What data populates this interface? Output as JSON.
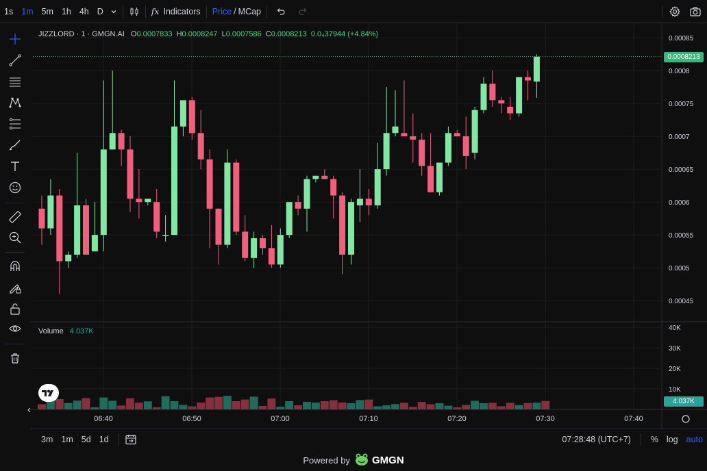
{
  "toolbar": {
    "timeframes": [
      "1s",
      "1m",
      "5m",
      "1h",
      "4h",
      "D"
    ],
    "active_timeframe": "1m",
    "indicators_label": "Indicators",
    "price_label": "Price",
    "slash": "/",
    "mcap_label": "MCap"
  },
  "legend": {
    "symbol": "JIZZLORD · 1 · GMGN.AI",
    "open_label": "O",
    "open": "0.0007833",
    "high_label": "H",
    "high": "0.0008247",
    "low_label": "L",
    "low": "0.0007586",
    "close_label": "C",
    "close": "0.0008213",
    "change": "0.0₄37944 (+4.84%)"
  },
  "volume_legend": {
    "label": "Volume",
    "value": "4.037K"
  },
  "last_price_tag": "0.0008213",
  "volume_tag": "4.037K",
  "bottombar": {
    "ranges": [
      "3m",
      "1m",
      "5d",
      "1d"
    ],
    "time": "07:28:48 (UTC+7)",
    "pct": "%",
    "log": "log",
    "auto": "auto"
  },
  "footer": {
    "powered_by": "Powered by",
    "brand": "GMGN"
  },
  "colors": {
    "up": "#80e8a3",
    "down": "#f0607d",
    "vol_up": "#1f6b5c",
    "vol_down": "#86303f",
    "accent": "#2962ff"
  },
  "chart_data": [
    {
      "type": "candlestick",
      "y_ticks": [
        "0.00085",
        "0.0008",
        "0.00075",
        "0.0007",
        "0.00065",
        "0.0006",
        "0.00055",
        "0.0005",
        "0.00045"
      ],
      "ylim": [
        0.00042,
        0.000872
      ],
      "x_ticks": [
        "06:40",
        "06:50",
        "07:00",
        "07:10",
        "07:20",
        "07:30",
        "07:40"
      ],
      "candles": [
        {
          "o": 0.00059,
          "h": 0.00061,
          "l": 0.000535,
          "c": 0.00056
        },
        {
          "o": 0.00056,
          "h": 0.000635,
          "l": 0.00055,
          "c": 0.00061
        },
        {
          "o": 0.00061,
          "h": 0.00062,
          "l": 0.00046,
          "c": 0.00051
        },
        {
          "o": 0.00051,
          "h": 0.000525,
          "l": 0.0005,
          "c": 0.00052
        },
        {
          "o": 0.00052,
          "h": 0.000675,
          "l": 0.000515,
          "c": 0.000595
        },
        {
          "o": 0.000595,
          "h": 0.000605,
          "l": 0.000525,
          "c": 0.00052
        },
        {
          "o": 0.000525,
          "h": 0.0006,
          "l": 0.000525,
          "c": 0.00055
        },
        {
          "o": 0.00055,
          "h": 0.000785,
          "l": 0.000525,
          "c": 0.00068
        },
        {
          "o": 0.00068,
          "h": 0.0008,
          "l": 0.00068,
          "c": 0.000705
        },
        {
          "o": 0.000705,
          "h": 0.00071,
          "l": 0.000655,
          "c": 0.00068
        },
        {
          "o": 0.00068,
          "h": 0.0007,
          "l": 0.000585,
          "c": 0.000605
        },
        {
          "o": 0.000605,
          "h": 0.00065,
          "l": 0.000575,
          "c": 0.0006
        },
        {
          "o": 0.0006,
          "h": 0.000605,
          "l": 0.000595,
          "c": 0.000605
        },
        {
          "o": 0.0006,
          "h": 0.00062,
          "l": 0.000545,
          "c": 0.000555
        },
        {
          "o": 0.00055,
          "h": 0.00058,
          "l": 0.00054,
          "c": 0.00055
        },
        {
          "o": 0.00055,
          "h": 0.000785,
          "l": 0.00055,
          "c": 0.000715
        },
        {
          "o": 0.000715,
          "h": 0.00075,
          "l": 0.0007,
          "c": 0.000755
        },
        {
          "o": 0.000755,
          "h": 0.00076,
          "l": 0.000695,
          "c": 0.000705
        },
        {
          "o": 0.000705,
          "h": 0.00074,
          "l": 0.00065,
          "c": 0.000665
        },
        {
          "o": 0.000665,
          "h": 0.00068,
          "l": 0.00053,
          "c": 0.00059
        },
        {
          "o": 0.00059,
          "h": 0.00059,
          "l": 0.000505,
          "c": 0.000535
        },
        {
          "o": 0.000535,
          "h": 0.00068,
          "l": 0.00053,
          "c": 0.00066
        },
        {
          "o": 0.00066,
          "h": 0.000665,
          "l": 0.00055,
          "c": 0.000555
        },
        {
          "o": 0.000555,
          "h": 0.00058,
          "l": 0.00051,
          "c": 0.000515
        },
        {
          "o": 0.000515,
          "h": 0.000555,
          "l": 0.0005,
          "c": 0.000545
        },
        {
          "o": 0.000545,
          "h": 0.00055,
          "l": 0.00052,
          "c": 0.00053
        },
        {
          "o": 0.00053,
          "h": 0.000565,
          "l": 0.0005,
          "c": 0.000505
        },
        {
          "o": 0.000505,
          "h": 0.00056,
          "l": 0.0005,
          "c": 0.00055
        },
        {
          "o": 0.00055,
          "h": 0.0006,
          "l": 0.000545,
          "c": 0.0006
        },
        {
          "o": 0.0006,
          "h": 0.00061,
          "l": 0.00058,
          "c": 0.00059
        },
        {
          "o": 0.00059,
          "h": 0.00064,
          "l": 0.000555,
          "c": 0.000635
        },
        {
          "o": 0.000635,
          "h": 0.00064,
          "l": 0.00063,
          "c": 0.00064
        },
        {
          "o": 0.00064,
          "h": 0.00065,
          "l": 0.000635,
          "c": 0.000635
        },
        {
          "o": 0.000635,
          "h": 0.00064,
          "l": 0.000575,
          "c": 0.00061
        },
        {
          "o": 0.00061,
          "h": 0.000615,
          "l": 0.00049,
          "c": 0.00052
        },
        {
          "o": 0.00052,
          "h": 0.000605,
          "l": 0.000505,
          "c": 0.0006
        },
        {
          "o": 0.000595,
          "h": 0.00065,
          "l": 0.00057,
          "c": 0.000605
        },
        {
          "o": 0.000605,
          "h": 0.00062,
          "l": 0.00058,
          "c": 0.000595
        },
        {
          "o": 0.000595,
          "h": 0.00069,
          "l": 0.00059,
          "c": 0.00065
        },
        {
          "o": 0.00065,
          "h": 0.000775,
          "l": 0.00064,
          "c": 0.000705
        },
        {
          "o": 0.000705,
          "h": 0.00077,
          "l": 0.0007,
          "c": 0.000715
        },
        {
          "o": 0.000705,
          "h": 0.000785,
          "l": 0.000705,
          "c": 0.0007
        },
        {
          "o": 0.0007,
          "h": 0.000735,
          "l": 0.00066,
          "c": 0.000695
        },
        {
          "o": 0.000695,
          "h": 0.000705,
          "l": 0.00064,
          "c": 0.000655
        },
        {
          "o": 0.000655,
          "h": 0.000705,
          "l": 0.000615,
          "c": 0.000615
        },
        {
          "o": 0.000615,
          "h": 0.00066,
          "l": 0.00061,
          "c": 0.00066
        },
        {
          "o": 0.00066,
          "h": 0.000715,
          "l": 0.000655,
          "c": 0.000705
        },
        {
          "o": 0.000705,
          "h": 0.00071,
          "l": 0.0007,
          "c": 0.0007
        },
        {
          "o": 0.0007,
          "h": 0.00073,
          "l": 0.00065,
          "c": 0.00067
        },
        {
          "o": 0.000675,
          "h": 0.000745,
          "l": 0.000665,
          "c": 0.00074
        },
        {
          "o": 0.00074,
          "h": 0.00079,
          "l": 0.000735,
          "c": 0.00078
        },
        {
          "o": 0.00078,
          "h": 0.0008,
          "l": 0.000745,
          "c": 0.000755
        },
        {
          "o": 0.000755,
          "h": 0.00076,
          "l": 0.000735,
          "c": 0.00075
        },
        {
          "o": 0.000745,
          "h": 0.00076,
          "l": 0.000725,
          "c": 0.000735
        },
        {
          "o": 0.000735,
          "h": 0.00079,
          "l": 0.00073,
          "c": 0.00079
        },
        {
          "o": 0.00079,
          "h": 0.0008,
          "l": 0.000755,
          "c": 0.000785
        },
        {
          "o": 0.0007833,
          "h": 0.0008247,
          "l": 0.0007586,
          "c": 0.0008213
        }
      ]
    },
    {
      "type": "bar",
      "series": [
        {
          "name": "Volume",
          "values": [
            2500,
            4200,
            5000,
            3100,
            4300,
            5500,
            1000,
            5800,
            4200,
            1900,
            5400,
            3300,
            3900,
            1000,
            6400,
            4000,
            2200,
            1500,
            3300,
            5800,
            6100,
            6600,
            4000,
            4800,
            6200,
            1700,
            5300,
            1300,
            4000,
            2000,
            3700,
            3300,
            4000,
            4500,
            3400,
            3000,
            4500,
            4800,
            1500,
            2000,
            2600,
            3200,
            1200,
            3600,
            2500,
            3000,
            1800,
            1000,
            2200,
            4200,
            3000,
            3200,
            1500,
            3200,
            2100,
            3100,
            3300,
            4037
          ]
        }
      ],
      "ylim": [
        0,
        40000
      ],
      "y_ticks": [
        "40K",
        "30K",
        "20K",
        "10K"
      ]
    }
  ]
}
